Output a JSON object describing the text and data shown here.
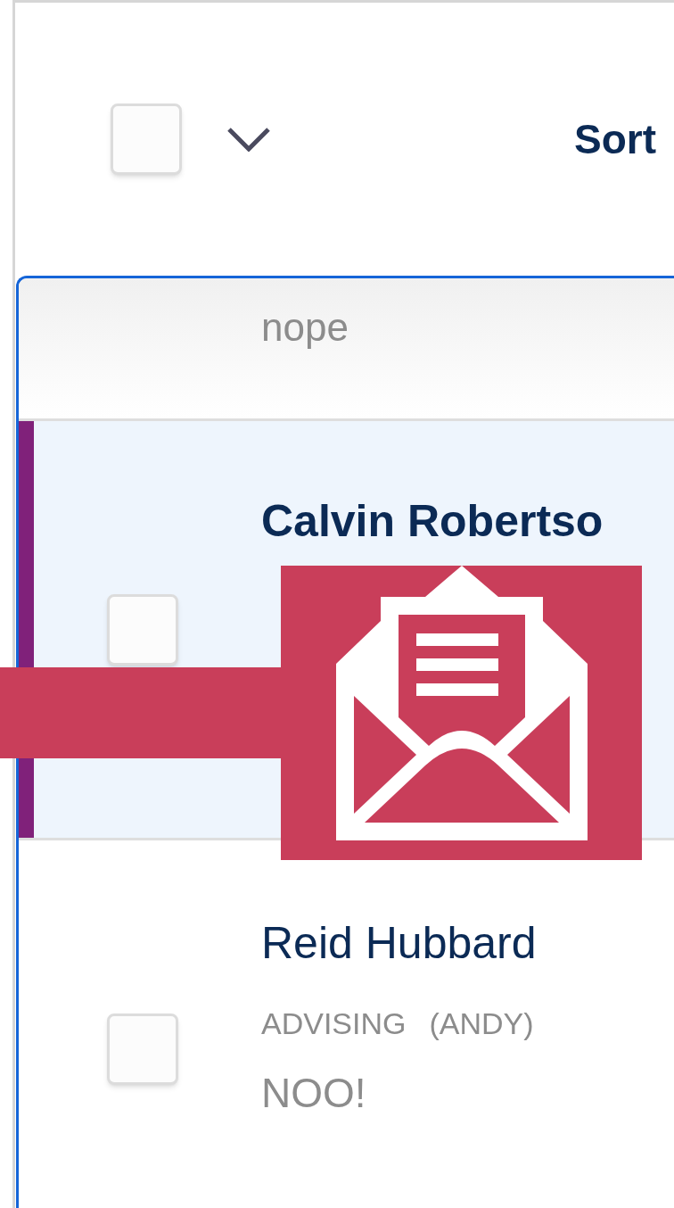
{
  "header": {
    "select_all": {
      "checked": false
    },
    "sort_label": "Sort"
  },
  "top_row": {
    "text": "nope"
  },
  "messages": [
    {
      "name": "Calvin Robertso",
      "selected": true,
      "checked": false
    },
    {
      "name": "Reid Hubbard",
      "selected": false,
      "checked": false,
      "tag": "ADVISING",
      "assignee": "(ANDY)",
      "preview": "NOO!"
    }
  ]
}
